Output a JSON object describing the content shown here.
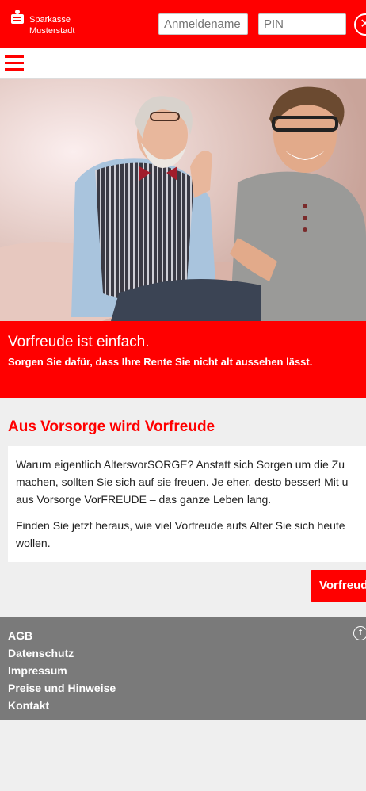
{
  "brand": {
    "line1": "Sparkasse",
    "line2": "Musterstadt"
  },
  "login": {
    "username_placeholder": "Anmeldename",
    "pin_placeholder": "PIN"
  },
  "header": {
    "close_label": "✕"
  },
  "banner": {
    "title": "Vorfreude ist einfach.",
    "subtitle": "Sorgen Sie dafür, dass Ihre Rente Sie nicht alt aussehen lässt."
  },
  "content": {
    "section_title": "Aus Vorsorge wird Vorfreude",
    "para1_line1": "Warum eigentlich AltersvorSORGE? Anstatt sich Sorgen um die Zu",
    "para1_line2": "machen, sollten Sie sich auf sie freuen. Je eher, desto besser! Mit u",
    "para1_line3": "aus Vorsorge VorFREUDE – das ganze Leben lang.",
    "para2_line1": "Finden Sie jetzt heraus, wie viel Vorfreude aufs Alter Sie sich heute",
    "para2_line2": "wollen.",
    "cta_label": "Vorfreude"
  },
  "footer": {
    "links": [
      "AGB",
      "Datenschutz",
      "Impressum",
      "Preise und Hinweise",
      "Kontakt"
    ],
    "social_icon": "f"
  },
  "colors": {
    "brand_red": "#ff0000",
    "footer_grey": "#7a7a7a",
    "page_bg": "#efefef"
  }
}
